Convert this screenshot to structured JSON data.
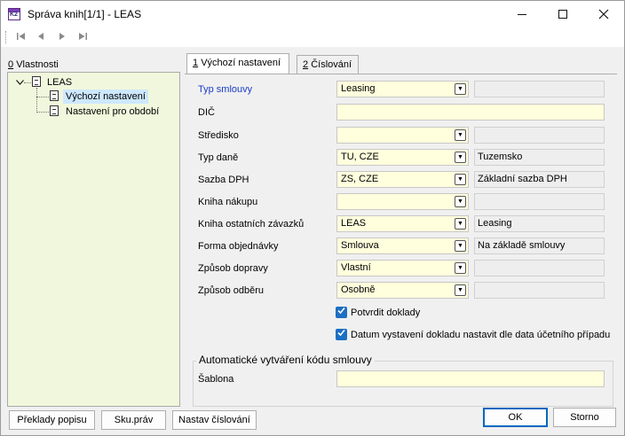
{
  "window": {
    "app_icon_text": "K2",
    "title": "Správa knih[1/1] - LEAS"
  },
  "nav": {
    "first_label": "|◀",
    "prev_label": "◀",
    "next_label": "▶",
    "last_label": "▶|"
  },
  "left_panel": {
    "label_mnemonic": "0",
    "label": "Vlastnosti",
    "tree": {
      "root": "LEAS",
      "children": [
        "Výchozí nastavení",
        "Nastavení pro období"
      ]
    }
  },
  "tabs": [
    {
      "mnemonic": "1",
      "label": "Výchozí nastavení"
    },
    {
      "mnemonic": "2",
      "label": "Číslování"
    }
  ],
  "form": {
    "typ_smlouvy": {
      "label": "Typ smlouvy",
      "value": "Leasing",
      "info": ""
    },
    "dic": {
      "label": "DIČ",
      "value": ""
    },
    "stredisko": {
      "label": "Středisko",
      "value": "",
      "info": ""
    },
    "typ_dane": {
      "label": "Typ daně",
      "value": "TU, CZE",
      "info": "Tuzemsko"
    },
    "sazba_dph": {
      "label": "Sazba DPH",
      "value": "ZS, CZE",
      "info": "Základní sazba DPH"
    },
    "kniha_nakupu": {
      "label": "Kniha nákupu",
      "value": "",
      "info": ""
    },
    "kniha_zavazku": {
      "label": "Kniha ostatních závazků",
      "value": "LEAS",
      "info": "Leasing"
    },
    "forma_objednavky": {
      "label": "Forma objednávky",
      "value": "Smlouva",
      "info": "Na základě smlouvy"
    },
    "zpusob_dopravy": {
      "label": "Způsob dopravy",
      "value": "Vlastní",
      "info": ""
    },
    "zpusob_odberu": {
      "label": "Způsob odběru",
      "value": "Osobně",
      "info": ""
    },
    "potvrdit_doklady": {
      "label": "Potvrdit doklady",
      "checked": true
    },
    "datum_vystaveni": {
      "label": "Datum vystavení dokladu nastavit dle data účetního případu",
      "checked": true
    }
  },
  "auto_code_group": {
    "title": "Automatické vytváření kódu smlouvy",
    "sablona_label": "Šablona",
    "sablona_value": ""
  },
  "buttons": {
    "preklady": "Překlady popisu",
    "sku_prav": "Sku.práv",
    "nastav_cislovani": "Nastav číslování",
    "ok": "OK",
    "storno": "Storno"
  },
  "icons": {
    "dropdown": "chevron-down-icon",
    "document": "document-icon",
    "checkbox": "check-icon"
  },
  "colors": {
    "required_label": "#1a3cc7",
    "input_bg": "#fffedd",
    "tree_bg": "#f1f7dc",
    "selection": "#cde8ff",
    "checkbox": "#1c6fc4",
    "default_button_border": "#0067c0"
  }
}
